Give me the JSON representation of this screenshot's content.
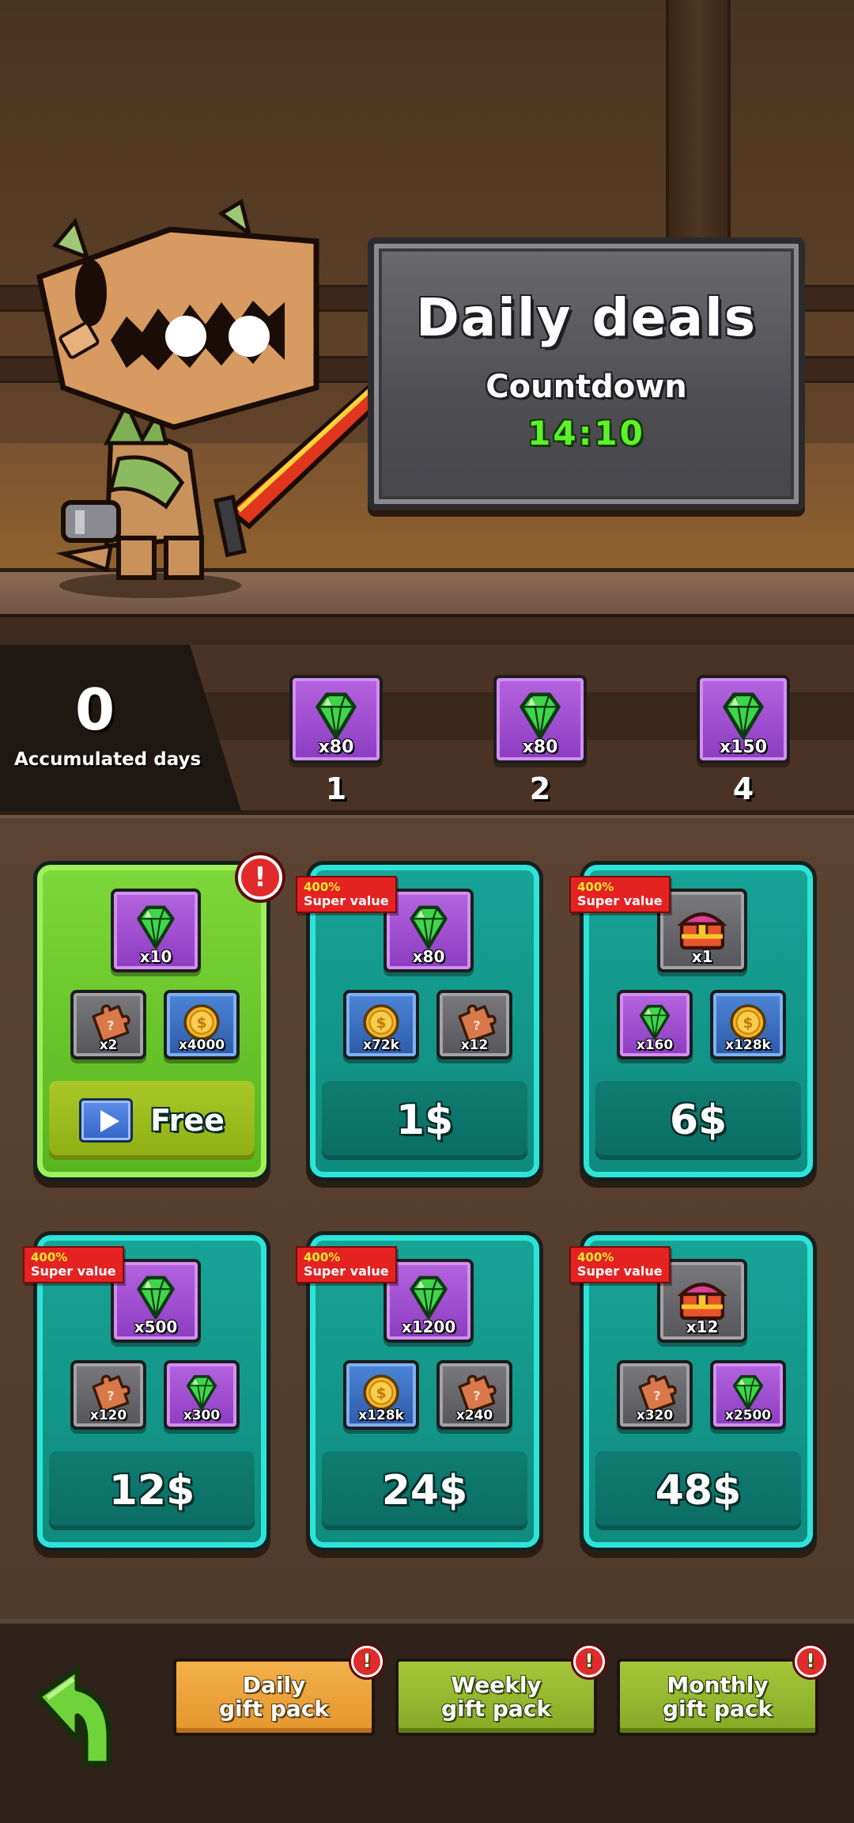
{
  "board": {
    "title": "Daily deals",
    "subtitle": "Countdown",
    "timer": "14:10"
  },
  "accumulated": {
    "count": "0",
    "label": "Accumulated days",
    "milestones": [
      {
        "icon": "gem-icon",
        "qty": "x80",
        "day": "1"
      },
      {
        "icon": "gem-icon",
        "qty": "x80",
        "day": "2"
      },
      {
        "icon": "gem-icon",
        "qty": "x150",
        "day": "4"
      }
    ]
  },
  "offers": [
    {
      "style": "green",
      "alert": "!",
      "badge": null,
      "main": {
        "icon": "gem-icon",
        "tile": "purple",
        "qty": "x10"
      },
      "extras": [
        {
          "icon": "puzzle-icon",
          "tile": "gray",
          "qty": "x2"
        },
        {
          "icon": "coin-icon",
          "tile": "blue",
          "qty": "x4000"
        }
      ],
      "price": "Free"
    },
    {
      "style": "teal",
      "badge": {
        "pct": "400%",
        "text": "Super value"
      },
      "main": {
        "icon": "gem-icon",
        "tile": "purple",
        "qty": "x80"
      },
      "extras": [
        {
          "icon": "coin-icon",
          "tile": "blue",
          "qty": "x72k"
        },
        {
          "icon": "puzzle-icon",
          "tile": "gray",
          "qty": "x12"
        }
      ],
      "price": "1$"
    },
    {
      "style": "teal",
      "badge": {
        "pct": "400%",
        "text": "Super value"
      },
      "main": {
        "icon": "chest-icon",
        "tile": "gray",
        "qty": "x1"
      },
      "extras": [
        {
          "icon": "gem-icon",
          "tile": "purple",
          "qty": "x160"
        },
        {
          "icon": "coin-icon",
          "tile": "blue",
          "qty": "x128k"
        }
      ],
      "price": "6$"
    },
    {
      "style": "teal",
      "badge": {
        "pct": "400%",
        "text": "Super value"
      },
      "main": {
        "icon": "gem-icon",
        "tile": "purple",
        "qty": "x500"
      },
      "extras": [
        {
          "icon": "puzzle-icon",
          "tile": "gray",
          "qty": "x120"
        },
        {
          "icon": "gem-icon",
          "tile": "purple",
          "qty": "x300"
        }
      ],
      "price": "12$"
    },
    {
      "style": "teal",
      "badge": {
        "pct": "400%",
        "text": "Super value"
      },
      "main": {
        "icon": "gem-icon",
        "tile": "purple",
        "qty": "x1200"
      },
      "extras": [
        {
          "icon": "coin-icon",
          "tile": "blue",
          "qty": "x128k"
        },
        {
          "icon": "puzzle-icon",
          "tile": "gray",
          "qty": "x240"
        }
      ],
      "price": "24$"
    },
    {
      "style": "teal",
      "badge": {
        "pct": "400%",
        "text": "Super value"
      },
      "main": {
        "icon": "chest-icon",
        "tile": "gray",
        "qty": "x12"
      },
      "extras": [
        {
          "icon": "puzzle-icon",
          "tile": "gray",
          "qty": "x320"
        },
        {
          "icon": "gem-icon",
          "tile": "purple",
          "qty": "x2500"
        }
      ],
      "price": "48$"
    }
  ],
  "footer": {
    "back_icon": "back-arrow-icon",
    "tabs": [
      {
        "label": "Daily\ngift pack",
        "active": true,
        "alert": "!"
      },
      {
        "label": "Weekly\ngift pack",
        "active": false,
        "alert": "!"
      },
      {
        "label": "Monthly\ngift pack",
        "active": false,
        "alert": "!"
      }
    ]
  },
  "colors": {
    "teal_card": "#17a496",
    "green_card": "#7fd83a",
    "timer": "#5cf22a",
    "badge": "#e42222",
    "active_tab": "#f3b04a",
    "idle_tab": "#a6c63a"
  }
}
